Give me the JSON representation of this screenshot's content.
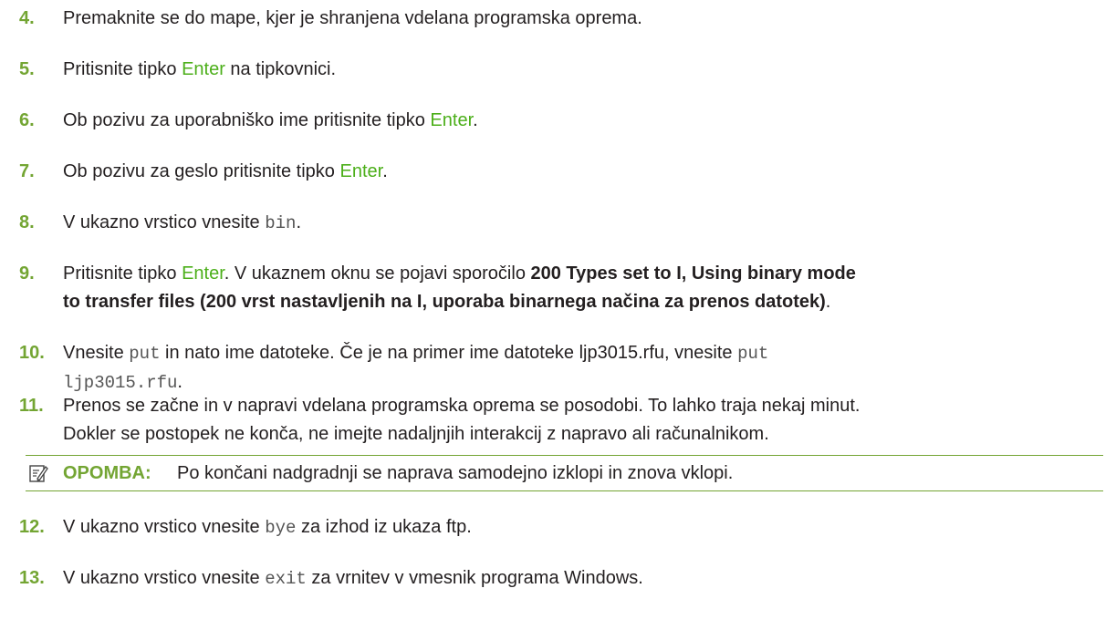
{
  "accent_color": "#73a533",
  "keyword_color": "#4caf1a",
  "steps": [
    {
      "num": "4.",
      "text": "Premaknite se do mape, kjer je shranjena vdelana programska oprema."
    },
    {
      "num": "5.",
      "pre": "Pritisnite tipko ",
      "key": "Enter",
      "post": " na tipkovnici."
    },
    {
      "num": "6.",
      "pre": "Ob pozivu za uporabniško ime pritisnite tipko ",
      "key": "Enter",
      "post": "."
    },
    {
      "num": "7.",
      "pre": "Ob pozivu za geslo pritisnite tipko ",
      "key": "Enter",
      "post": "."
    },
    {
      "num": "8.",
      "pre": "V ukazno vrstico vnesite ",
      "code": "bin",
      "post": "."
    },
    {
      "num": "9.",
      "pre": "Pritisnite tipko ",
      "key": "Enter",
      "mid": ". V ukaznem oknu se pojavi sporočilo ",
      "bold_line1": "200 Types set to I, Using binary mode",
      "bold_line2": "to transfer files (200 vrst nastavljenih na I, uporaba binarnega načina za prenos datotek)",
      "post": "."
    },
    {
      "num": "10.",
      "pre": "Vnesite ",
      "code1": "put",
      "mid": " in nato ime datoteke. Če je na primer ime datoteke ljp3015.rfu, vnesite ",
      "code2a": "put",
      "code2b": "ljp3015.rfu",
      "post": "."
    },
    {
      "num": "11.",
      "line1": "Prenos se začne in v napravi vdelana programska oprema se posodobi. To lahko traja nekaj minut.",
      "line2": "Dokler se postopek ne konča, ne imejte nadaljnjih interakcij z napravo ali računalnikom."
    },
    {
      "num": "12.",
      "pre": "V ukazno vrstico vnesite ",
      "code": "bye",
      "post": " za izhod iz ukaza ftp."
    },
    {
      "num": "13.",
      "pre": "V ukazno vrstico vnesite ",
      "code": "exit",
      "post": " za vrnitev v vmesnik programa Windows."
    }
  ],
  "note": {
    "icon": "note-pencil-icon",
    "label": "OPOMBA:",
    "text": "Po končani nadgradnji se naprava samodejno izklopi in znova vklopi."
  }
}
